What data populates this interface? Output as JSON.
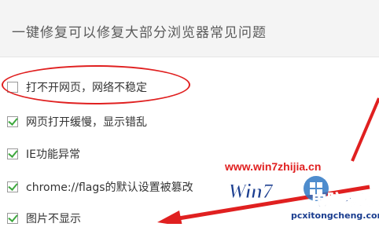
{
  "header": {
    "title": "一键修复可以修复大部分浏览器常见问题"
  },
  "options": [
    {
      "label": "打不开网页，网络不稳定",
      "checked": false
    },
    {
      "label": "网页打开缓慢，显示错乱",
      "checked": true
    },
    {
      "label": "IE功能异常",
      "checked": true
    },
    {
      "label": "chrome://flags的默认设置被篡改",
      "checked": true
    },
    {
      "label": "图片不显示",
      "checked": true
    }
  ],
  "watermark": {
    "url": "www.win7zhijia.cn",
    "logo_text": "Win7",
    "brand": "电脑系统城",
    "domain": "pcxitongcheng.com"
  },
  "colors": {
    "accent_red": "#e02020",
    "check_green": "#3ea83e"
  }
}
